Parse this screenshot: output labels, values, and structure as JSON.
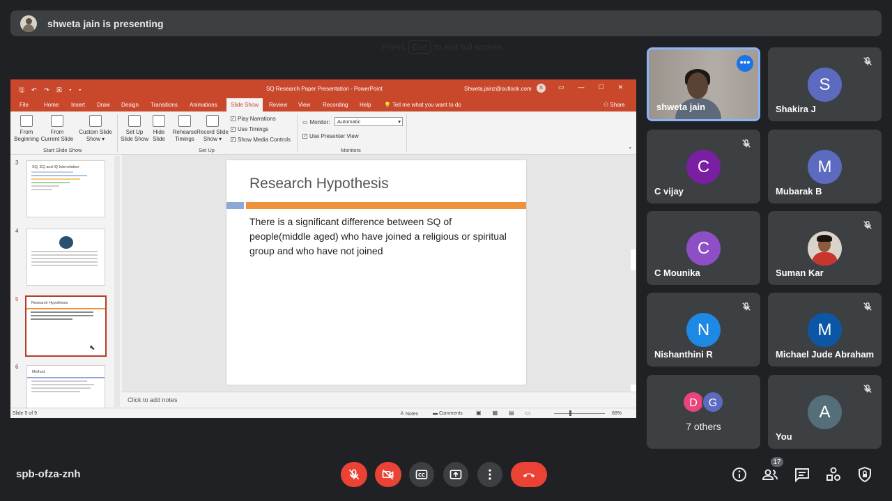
{
  "presenter": {
    "text": "shweta jain is presenting"
  },
  "fullscreen_hint": {
    "press": "Press",
    "key": "Esc",
    "rest": "to exit full screen"
  },
  "ppt": {
    "qat": "🖫 ↶ ↷ ▣ ▾ ▾",
    "doc_title": "SQ Research Paper Presentation  -  PowerPoint",
    "account": "Shweta.jainz@outlook.com",
    "account_initial": "S",
    "window_buttons": [
      "▭",
      "—",
      "☐",
      "✕"
    ],
    "tabs": [
      "File",
      "Home",
      "Insert",
      "Draw",
      "Design",
      "Transitions",
      "Animations",
      "Slide Show",
      "Review",
      "View",
      "Recording",
      "Help"
    ],
    "active_tab": "Slide Show",
    "tell_me": "Tell me what you want to do",
    "share": "Share",
    "ribbon": {
      "from_beginning_1": "From",
      "from_beginning_2": "Beginning",
      "from_current_1": "From",
      "from_current_2": "Current Slide",
      "custom_show_1": "Custom Slide",
      "custom_show_2": "Show ▾",
      "group_start": "Start Slide Show",
      "setup_show_1": "Set Up",
      "setup_show_2": "Slide Show",
      "hide_slide_1": "Hide",
      "hide_slide_2": "Slide",
      "rehearse_1": "Rehearse",
      "rehearse_2": "Timings",
      "record_1": "Record Slide",
      "record_2": "Show ▾",
      "play_narrations": "Play Narrations",
      "use_timings": "Use Timings",
      "show_media_controls": "Show Media Controls",
      "group_setup": "Set Up",
      "monitor_label": "Monitor:",
      "monitor_value": "Automatic",
      "use_presenter_view": "Use Presenter View",
      "group_monitors": "Monitors"
    },
    "thumbnails": [
      {
        "num": "3",
        "title": "SQ, EQ and IQ Interrelation"
      },
      {
        "num": "4",
        "title": ""
      },
      {
        "num": "5",
        "title": "Research Hypothesis"
      },
      {
        "num": "6",
        "title": "Method"
      }
    ],
    "slide": {
      "title": "Research Hypothesis",
      "body": "There is a significant difference between SQ of people(middle aged) who have joined a religious or spiritual group and who have not joined"
    },
    "notes_placeholder": "Click to add notes",
    "status": {
      "slide_count": "Slide 5 of 9",
      "notes": "Notes",
      "comments": "Comments",
      "zoom": "68%"
    }
  },
  "participants": [
    {
      "name": "shweta jain",
      "type": "video",
      "active": true
    },
    {
      "name": "Shakira J",
      "initial": "S",
      "color": "#5c6bc0",
      "muted": true
    },
    {
      "name": "C vijay",
      "initial": "C",
      "color": "#7b1fa2",
      "muted": true
    },
    {
      "name": "Mubarak B",
      "initial": "M",
      "color": "#5c6bc0",
      "muted": false
    },
    {
      "name": "C Mounika",
      "initial": "C",
      "color": "#8e4ec6",
      "muted": false
    },
    {
      "name": "Suman Kar",
      "type": "photo",
      "muted": true
    },
    {
      "name": "Nishanthini R",
      "initial": "N",
      "color": "#1e88e5",
      "muted": true
    },
    {
      "name": "Michael Jude Abraham",
      "initial": "M",
      "color": "#0b57a5",
      "muted": true
    },
    {
      "name": "You",
      "initial": "A",
      "color": "#546e7a",
      "muted": true
    }
  ],
  "others": {
    "label": "7 others",
    "avatars": [
      {
        "initial": "D",
        "color": "#e8457c"
      },
      {
        "initial": "G",
        "color": "#5c6bc0"
      }
    ]
  },
  "meeting_code": "spb-ofza-znh",
  "people_count": "17",
  "icons": [
    "mic-off-icon",
    "camera-off-icon",
    "captions-icon",
    "present-icon",
    "more-options-icon",
    "end-call-icon",
    "info-icon",
    "people-icon",
    "chat-icon",
    "activities-icon",
    "host-controls-icon"
  ]
}
